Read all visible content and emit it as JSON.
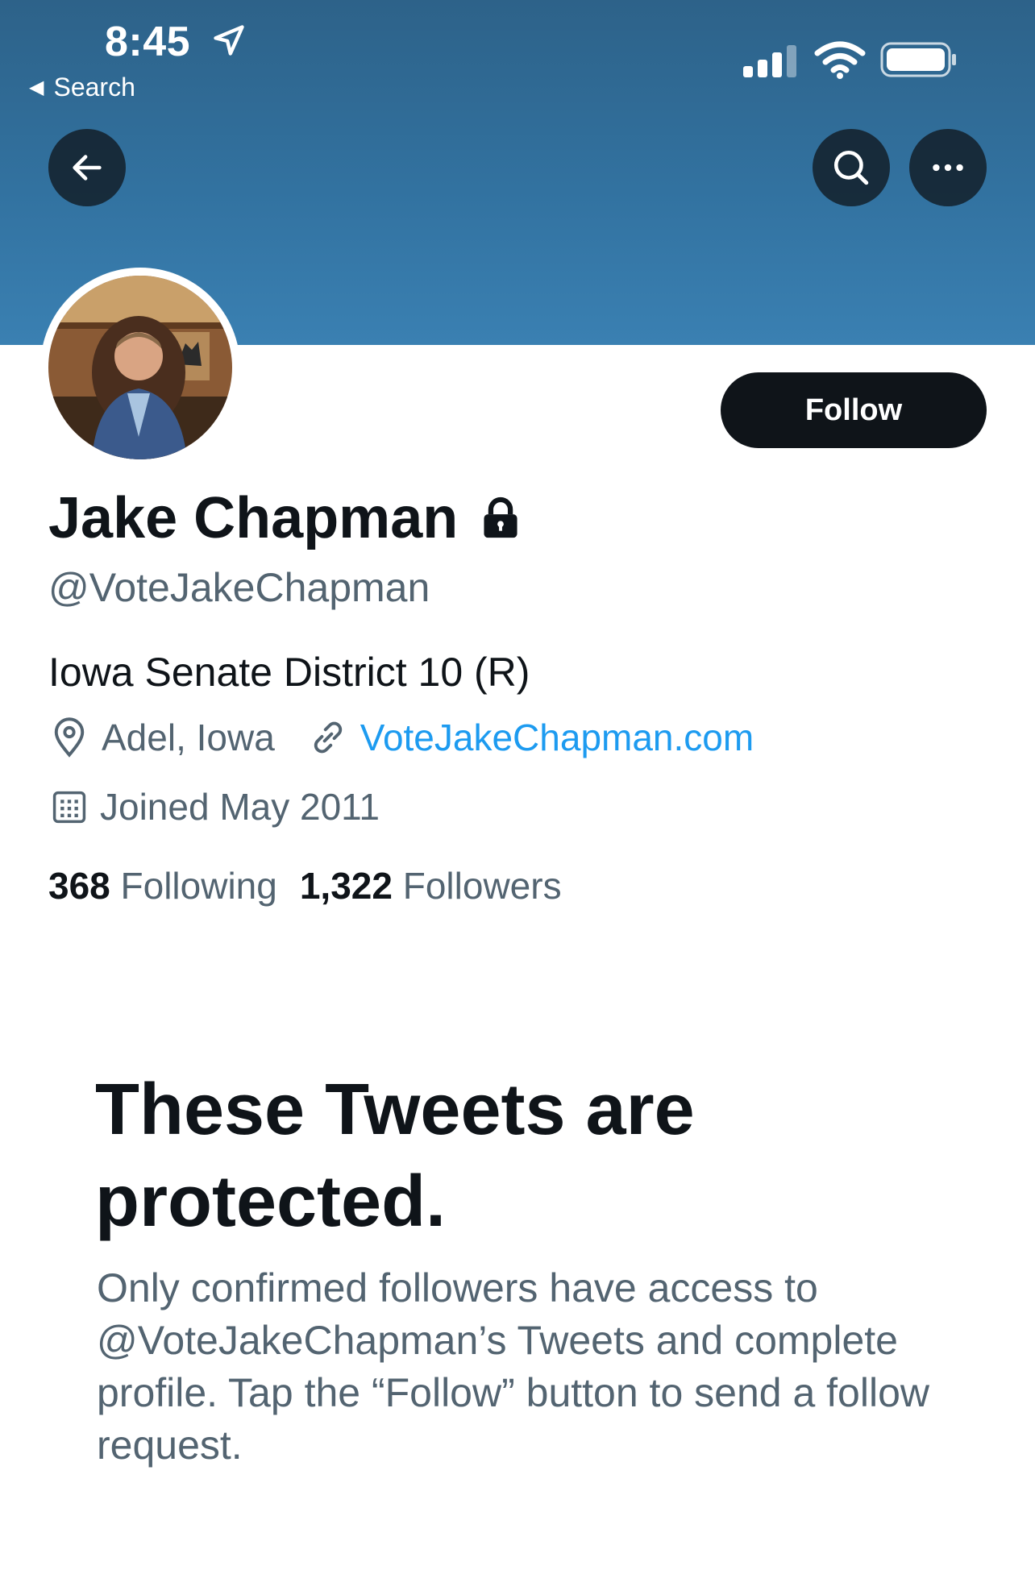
{
  "status_bar": {
    "time": "8:45",
    "back_app": "Search"
  },
  "profile": {
    "display_name": "Jake Chapman",
    "handle": "@VoteJakeChapman",
    "bio": "Iowa Senate District 10 (R)",
    "location": "Adel, Iowa",
    "website": "VoteJakeChapman.com",
    "joined": "Joined May 2011",
    "following_count": "368",
    "following_label": "Following",
    "followers_count": "1,322",
    "followers_label": "Followers"
  },
  "actions": {
    "follow_label": "Follow"
  },
  "protected_notice": {
    "title": "These Tweets are protected.",
    "description": "Only confirmed followers have access to @VoteJakeChapman’s Tweets and complete profile. Tap the “Follow” button to send a follow request."
  },
  "colors": {
    "banner": "#3272a0",
    "link": "#1d9bf0",
    "secondary_text": "#536471",
    "primary_text": "#0f1419"
  },
  "icons": [
    "location-arrow-icon",
    "signal-icon",
    "wifi-icon",
    "battery-icon",
    "back-arrow-icon",
    "search-icon",
    "more-icon",
    "lock-icon",
    "location-pin-icon",
    "link-icon",
    "calendar-icon"
  ]
}
